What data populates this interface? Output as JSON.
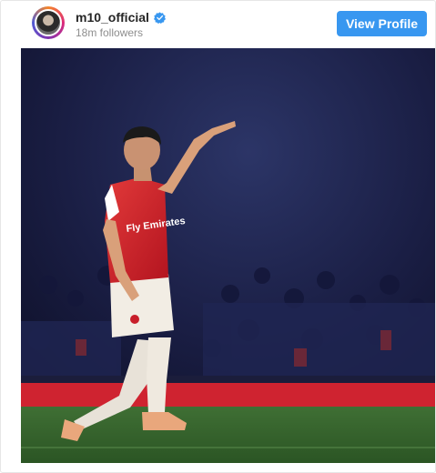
{
  "post": {
    "username": "m10_official",
    "followers": "18m followers",
    "view_profile_label": "View Profile",
    "verified": true,
    "image": {
      "description_icon": "photo",
      "shirt_text": "Fly Emirates"
    }
  },
  "colors": {
    "button": "#3897f0",
    "verified": "#3897f0",
    "username": "#262626",
    "muted": "#8e8e8e",
    "kit_red": "#d5202a"
  }
}
